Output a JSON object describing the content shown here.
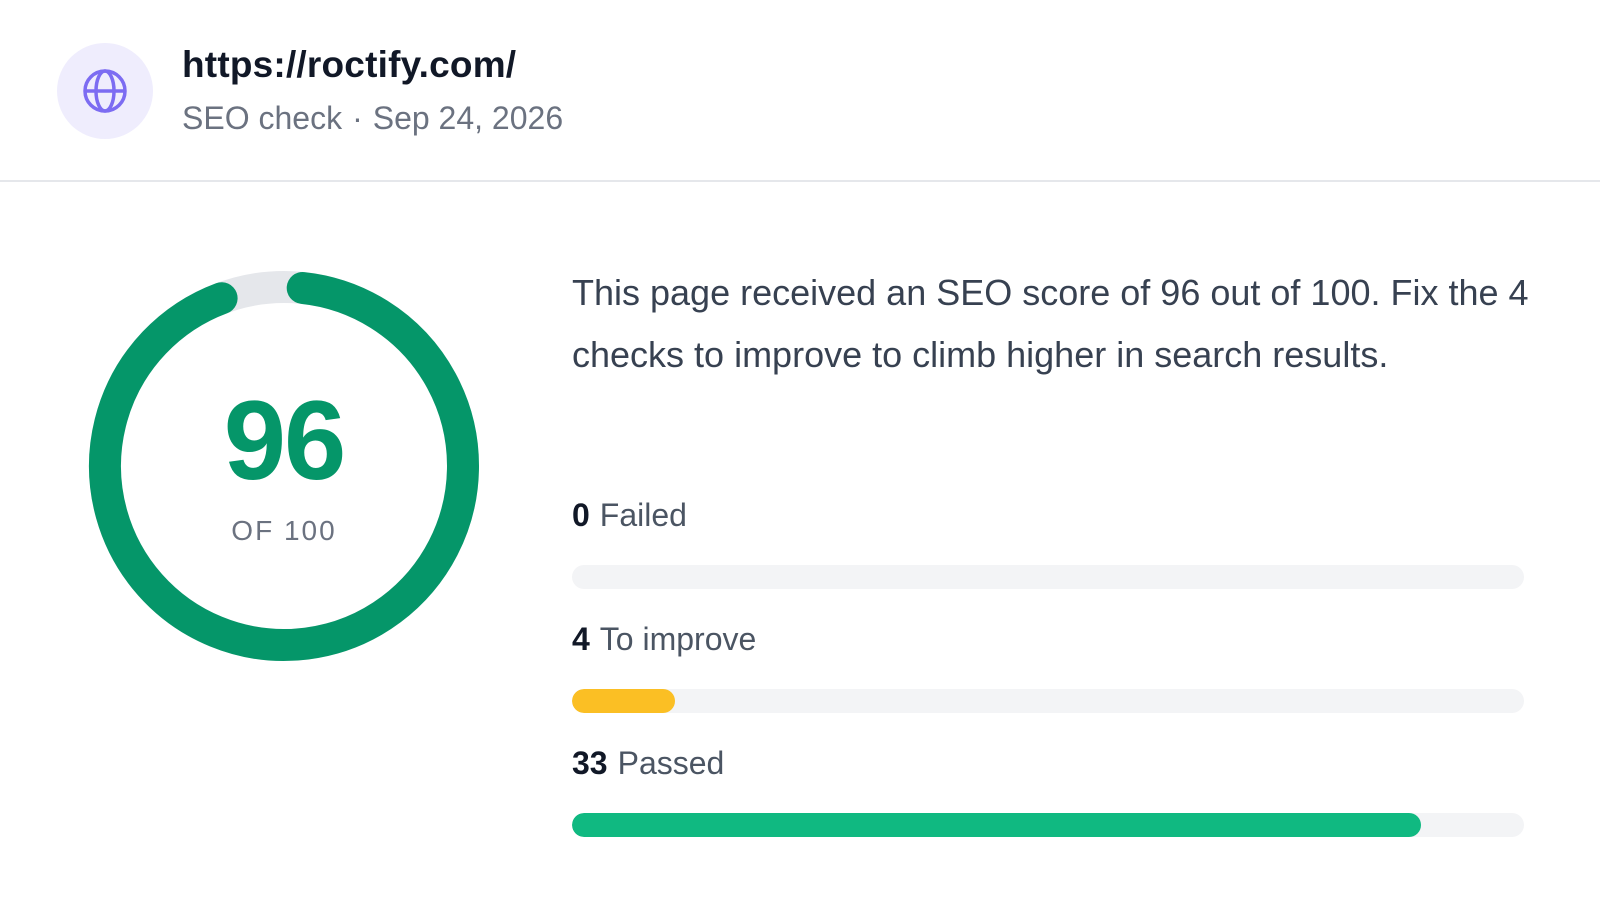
{
  "header": {
    "url": "https://roctify.com/",
    "check_type": "SEO check",
    "separator": "·",
    "date": "Sep 24, 2026",
    "icon": "globe-icon"
  },
  "score": {
    "value": 96,
    "value_text": "96",
    "of_label": "OF 100",
    "max": 100,
    "color": "#059669"
  },
  "summary": {
    "text": "This page received an SEO score of 96 out of 100. Fix the 4 checks to improve to climb higher in search results."
  },
  "metrics": [
    {
      "count": "0",
      "label": "Failed",
      "fraction": 0,
      "color": "#ef4444"
    },
    {
      "count": "4",
      "label": "To improve",
      "fraction": 0.108,
      "color": "#fbbf24"
    },
    {
      "count": "33",
      "label": "Passed",
      "fraction": 0.892,
      "color": "#10b981"
    }
  ]
}
